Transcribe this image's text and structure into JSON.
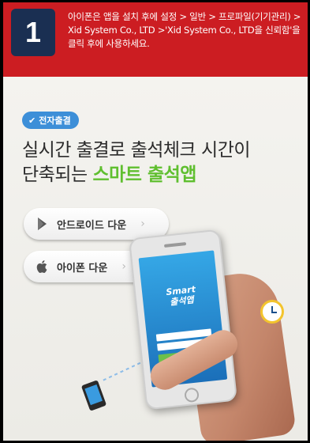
{
  "header": {
    "step_number": "1",
    "instruction": "아이폰은 앱을 설치 후에 설정 > 일반 > 프로파일(기기관리) > Xid System Co., LTD >'Xid System Co., LTD을 신뢰함'을 클릭 후에 사용하세요.",
    "background_color": "#cc1d22",
    "step_box_color": "#1a2f52"
  },
  "promo": {
    "tag_label": "전자출결",
    "headline_line1": "실시간 출결로 출석체크 시간이",
    "headline_line2_prefix": "단축되는",
    "headline_line2_highlight": "스마트 출석앱",
    "accent_color": "#5fbf2f"
  },
  "buttons": {
    "android_label": "안드로이드 다운",
    "ios_label": "아이폰 다운",
    "chevron": "›"
  },
  "phone_screen": {
    "app_name_line1": "Smart",
    "app_name_line2": "출석앱"
  }
}
